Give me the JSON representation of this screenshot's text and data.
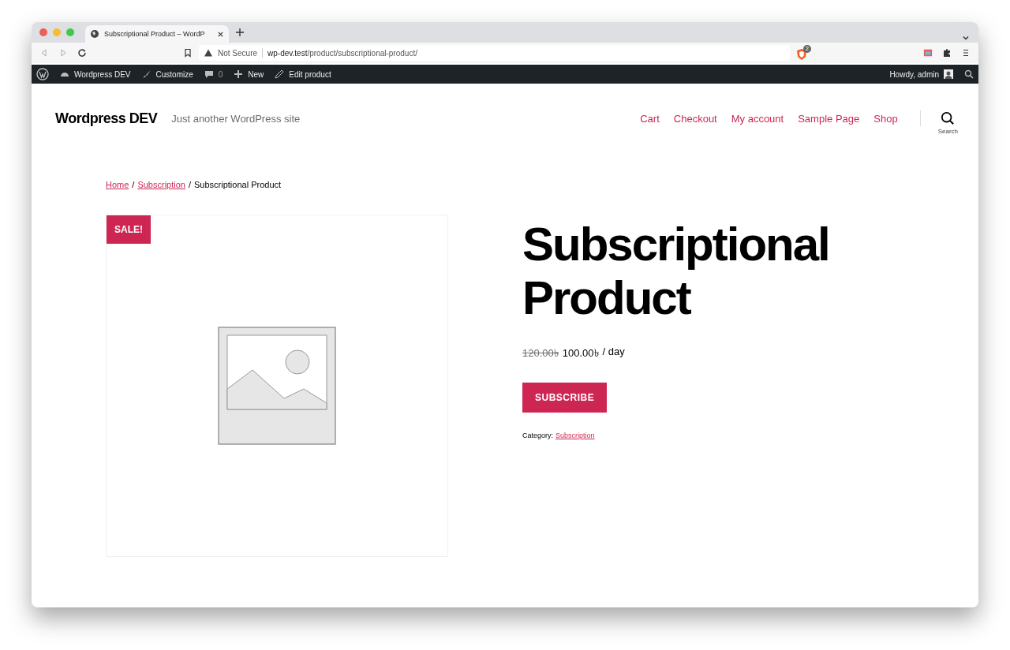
{
  "browser": {
    "tab_title": "Subscriptional Product – WordP",
    "security": "Not Secure",
    "url_host": "wp-dev.test",
    "url_path": "/product/subscriptional-product/",
    "shield_count": "2"
  },
  "admin_bar": {
    "items": [
      {
        "kind": "site",
        "label": "Wordpress DEV"
      },
      {
        "kind": "customize",
        "label": "Customize"
      },
      {
        "kind": "comments",
        "label": "0"
      },
      {
        "kind": "new",
        "label": "New"
      },
      {
        "kind": "edit",
        "label": "Edit product"
      }
    ],
    "greeting": "Howdy, admin"
  },
  "site": {
    "title": "Wordpress DEV",
    "tagline": "Just another WordPress site",
    "nav": [
      "Cart",
      "Checkout",
      "My account",
      "Sample Page",
      "Shop"
    ],
    "search_label": "Search"
  },
  "breadcrumb": {
    "links": [
      "Home",
      "Subscription"
    ],
    "separator": "/",
    "current": "Subscriptional Product"
  },
  "product": {
    "badge": "SALE!",
    "title": "Subscriptional Product",
    "old_price": "120.00৳",
    "price": "100.00৳",
    "period": "/ day",
    "button": "SUBSCRIBE",
    "category_label": "Category:",
    "category": "Subscription"
  }
}
